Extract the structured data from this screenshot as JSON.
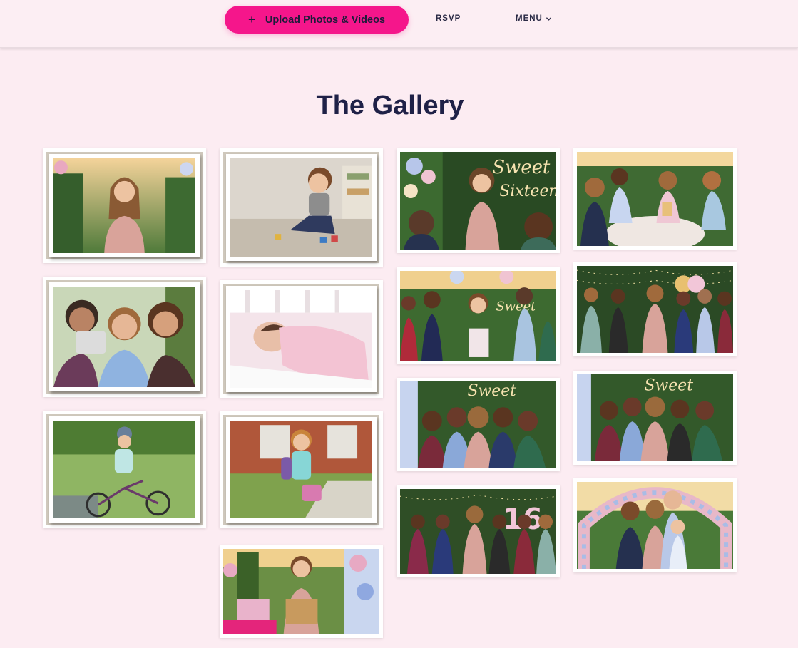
{
  "header": {
    "upload_label": "Upload Photos & Videos",
    "upload_icon": "plus-icon",
    "rsvp_label": "RSVP",
    "menu_label": "MENU",
    "menu_icon": "chevron-down-icon",
    "accent_color": "#f5168b"
  },
  "gallery": {
    "title": "The Gallery",
    "photos": [
      "Birthday girl portrait",
      "Toddler playing with blocks",
      "Girl giving speech at Sweet Sixteen sign",
      "Family dinner at table",
      "Three friends taking selfie",
      "Newborn in crib",
      "Girl blowing out cake candles",
      "Friends dancing under string lights",
      "Girl riding bike",
      "Girl with backpack at school",
      "Group selfie at Sweet sign",
      "Friends posing at Sweet sign",
      "Party celebration with 16 balloons",
      "Family portrait at flower arch",
      "Opening presents"
    ],
    "sign_texts": {
      "sweet": "Sweet",
      "sixteen": "Sixteen",
      "sixteen_num": "16"
    }
  }
}
